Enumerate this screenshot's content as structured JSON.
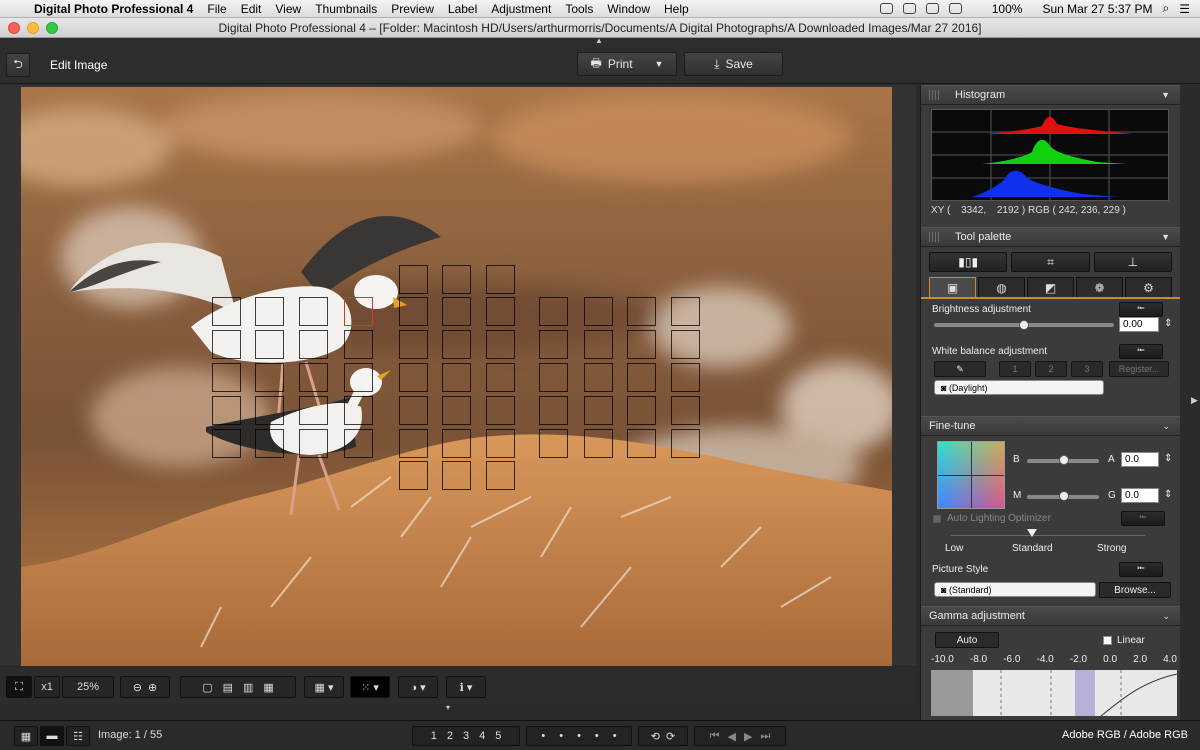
{
  "menubar": {
    "app_name": "Digital Photo Professional 4",
    "items": [
      "File",
      "Edit",
      "View",
      "Thumbnails",
      "Preview",
      "Label",
      "Adjustment",
      "Tools",
      "Window",
      "Help"
    ],
    "battery": "100%",
    "datetime": "Sun Mar 27  5:37 PM"
  },
  "window": {
    "title": "Digital Photo Professional 4 – [Folder: Macintosh HD/Users/arthurmorris/Documents/A Digital Photographs/A Downloaded Images/Mar 27 2016]"
  },
  "toolbar": {
    "mode_label": "Edit Image",
    "print_label": "Print",
    "save_label": "Save"
  },
  "histogram": {
    "title": "Histogram",
    "xy_label": "XY (",
    "x": "3342",
    "y": "2192",
    "rgb_label": ") RGB (",
    "r": "242",
    "g": "236",
    "b": "229",
    "close": ")",
    "colors": {
      "red": "#e01010",
      "green": "#10d010",
      "blue": "#1030f0"
    }
  },
  "tool_palette": {
    "title": "Tool palette",
    "brightness_label": "Brightness adjustment",
    "brightness_value": "0.00",
    "brightness_fraction": 0.5,
    "wb_label": "White balance adjustment",
    "wb_buttons": [
      "1",
      "2",
      "3",
      "Register..."
    ],
    "wb_value": "(Daylight)",
    "finetune_label": "Fine-tune",
    "b_label": "B",
    "a_label": "A",
    "m_label": "M",
    "g_label": "G",
    "ba_value": "0.0",
    "mg_value": "0.0",
    "alo_label": "Auto Lighting Optimizer",
    "alo_levels": [
      "Low",
      "Standard",
      "Strong"
    ],
    "picture_style_label": "Picture Style",
    "picture_style_value": "(Standard)",
    "browse_label": "Browse...",
    "gamma_label": "Gamma adjustment",
    "auto_label": "Auto",
    "linear_label": "Linear",
    "gamma_ticks": [
      "-10.0",
      "-8.0",
      "-6.0",
      "-4.0",
      "-2.0",
      "0.0",
      "2.0",
      "4.0"
    ]
  },
  "bottom": {
    "zoom_x1": "x1",
    "zoom_value": "25%",
    "image_counter": "Image: 1 / 55",
    "ratings": [
      "1",
      "2",
      "3",
      "4",
      "5"
    ],
    "color_space": "Adobe RGB / Adobe RGB"
  }
}
